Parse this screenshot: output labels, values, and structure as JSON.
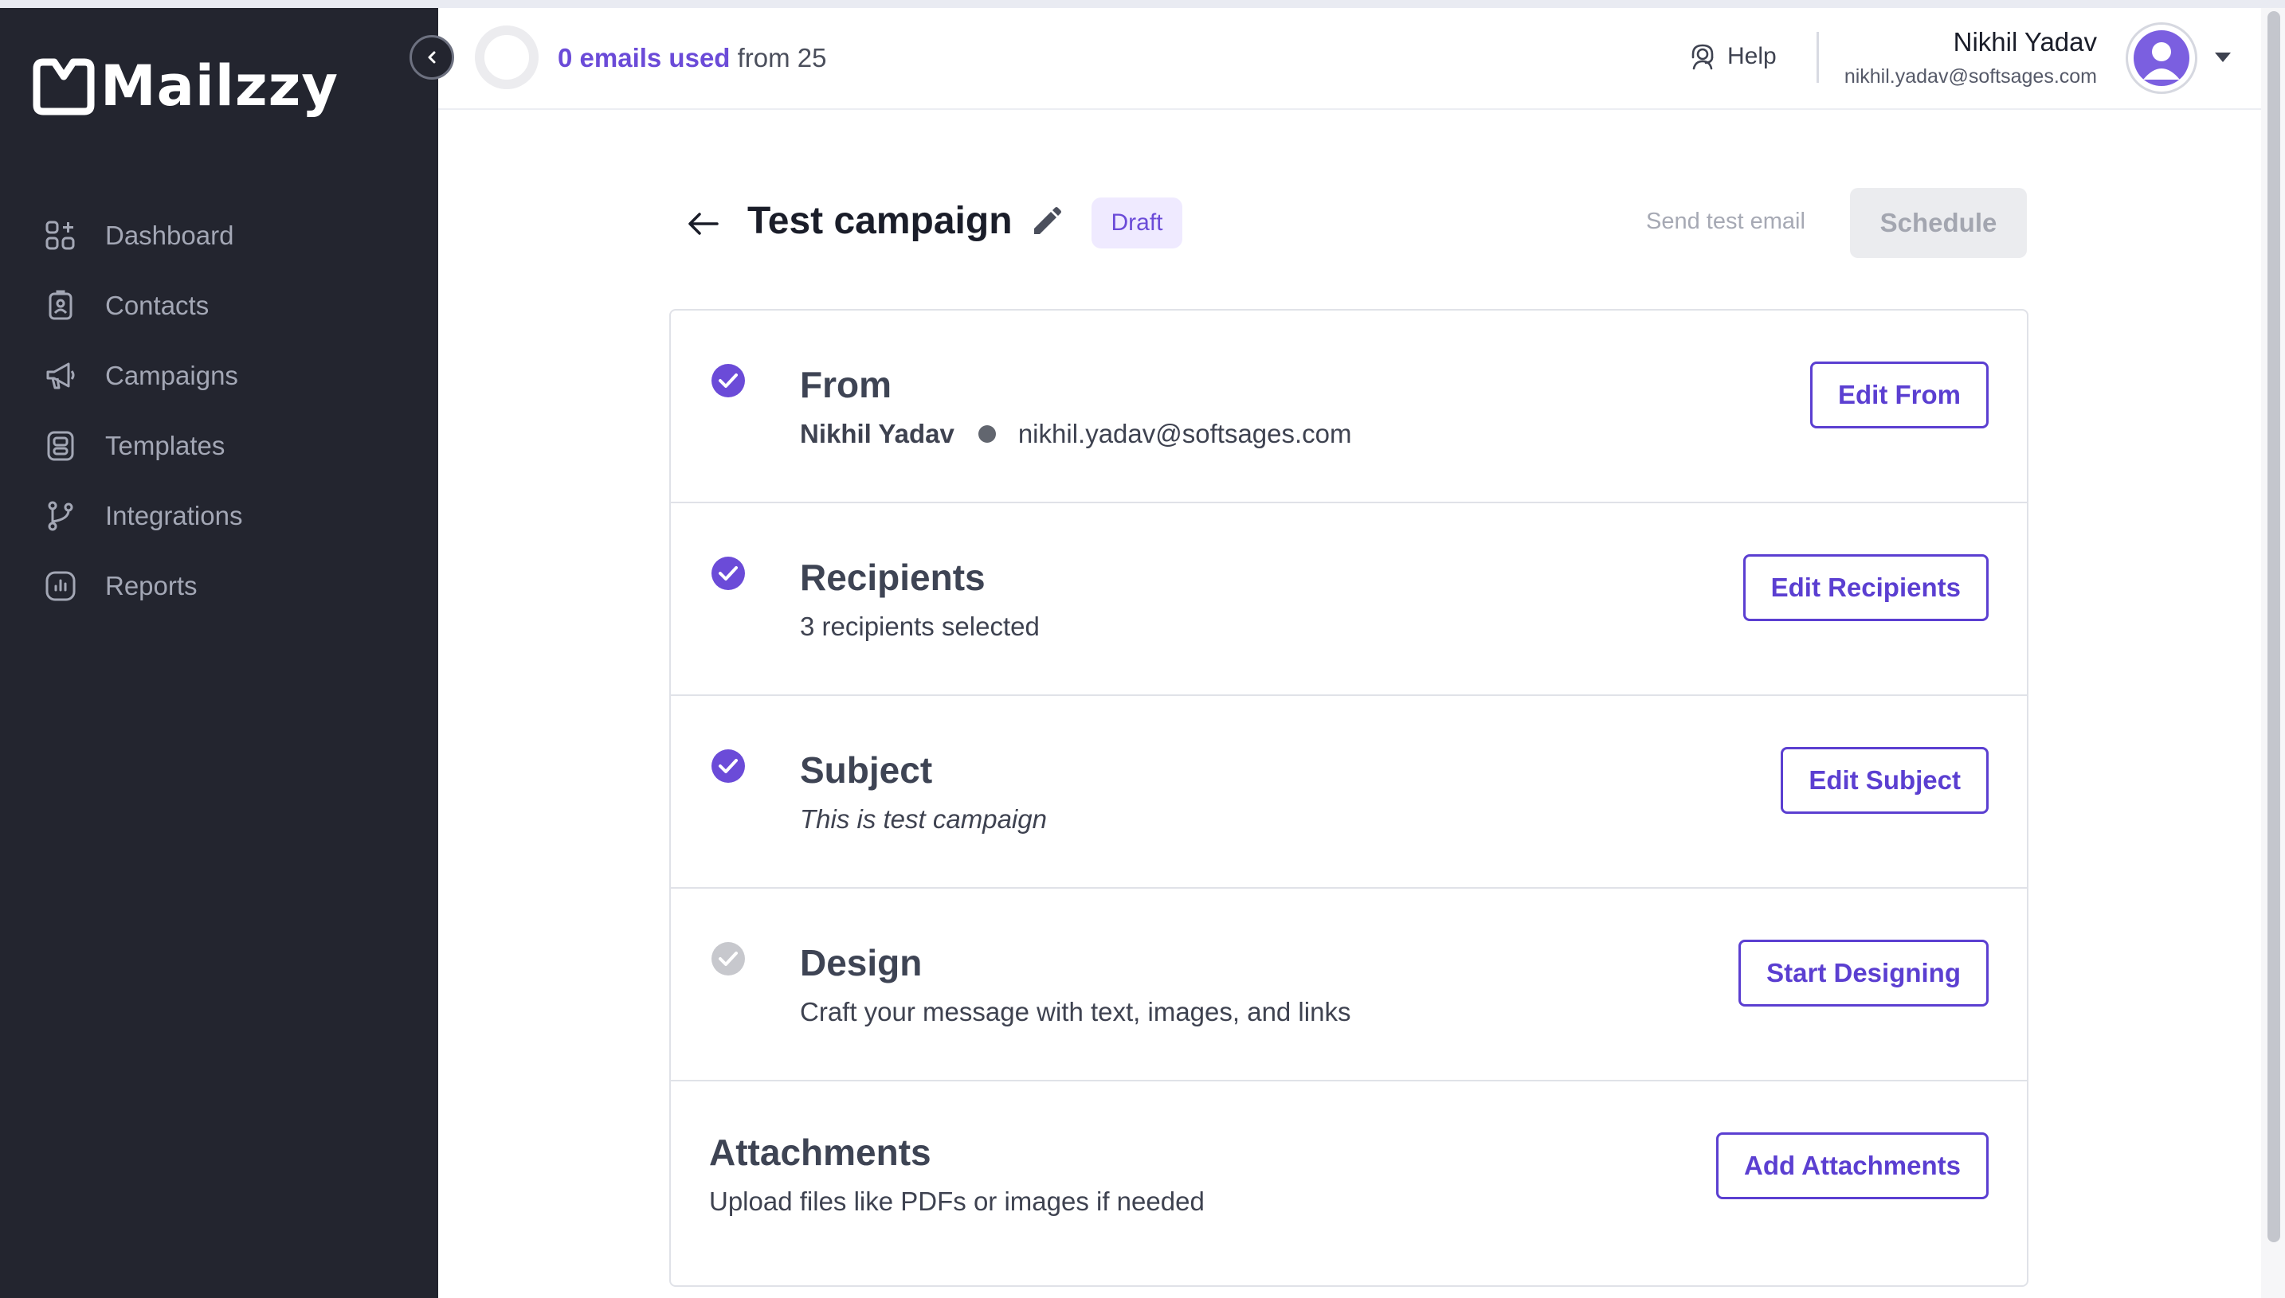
{
  "app": {
    "name": "Mailzzy"
  },
  "sidebar": {
    "items": [
      {
        "label": "Dashboard",
        "icon": "dashboard-icon"
      },
      {
        "label": "Contacts",
        "icon": "contacts-icon"
      },
      {
        "label": "Campaigns",
        "icon": "megaphone-icon"
      },
      {
        "label": "Templates",
        "icon": "templates-icon"
      },
      {
        "label": "Integrations",
        "icon": "branch-icon"
      },
      {
        "label": "Reports",
        "icon": "reports-icon"
      }
    ]
  },
  "header": {
    "usage_used": "0 emails used",
    "usage_total": "from 25",
    "help_label": "Help",
    "user_name": "Nikhil Yadav",
    "user_email": "nikhil.yadav@softsages.com"
  },
  "campaign": {
    "title": "Test campaign",
    "status": "Draft",
    "send_test_label": "Send test email",
    "schedule_label": "Schedule"
  },
  "sections": {
    "from": {
      "title": "From",
      "name": "Nikhil Yadav",
      "email": "nikhil.yadav@softsages.com",
      "button": "Edit From",
      "completed": true
    },
    "recipients": {
      "title": "Recipients",
      "summary": "3 recipients selected",
      "button": "Edit Recipients",
      "completed": true
    },
    "subject": {
      "title": "Subject",
      "value": "This is test campaign",
      "button": "Edit Subject",
      "completed": true
    },
    "design": {
      "title": "Design",
      "description": "Craft your message with text, images, and links",
      "button": "Start Designing",
      "completed": false
    },
    "attachments": {
      "title": "Attachments",
      "description": "Upload files like PDFs or images if needed",
      "button": "Add Attachments"
    }
  },
  "colors": {
    "sidebar_bg": "#23252f",
    "accent": "#5b3fd1",
    "badge_bg": "#efeaff",
    "check_done": "#6b4bd8",
    "check_pending": "#c7c8cd"
  }
}
